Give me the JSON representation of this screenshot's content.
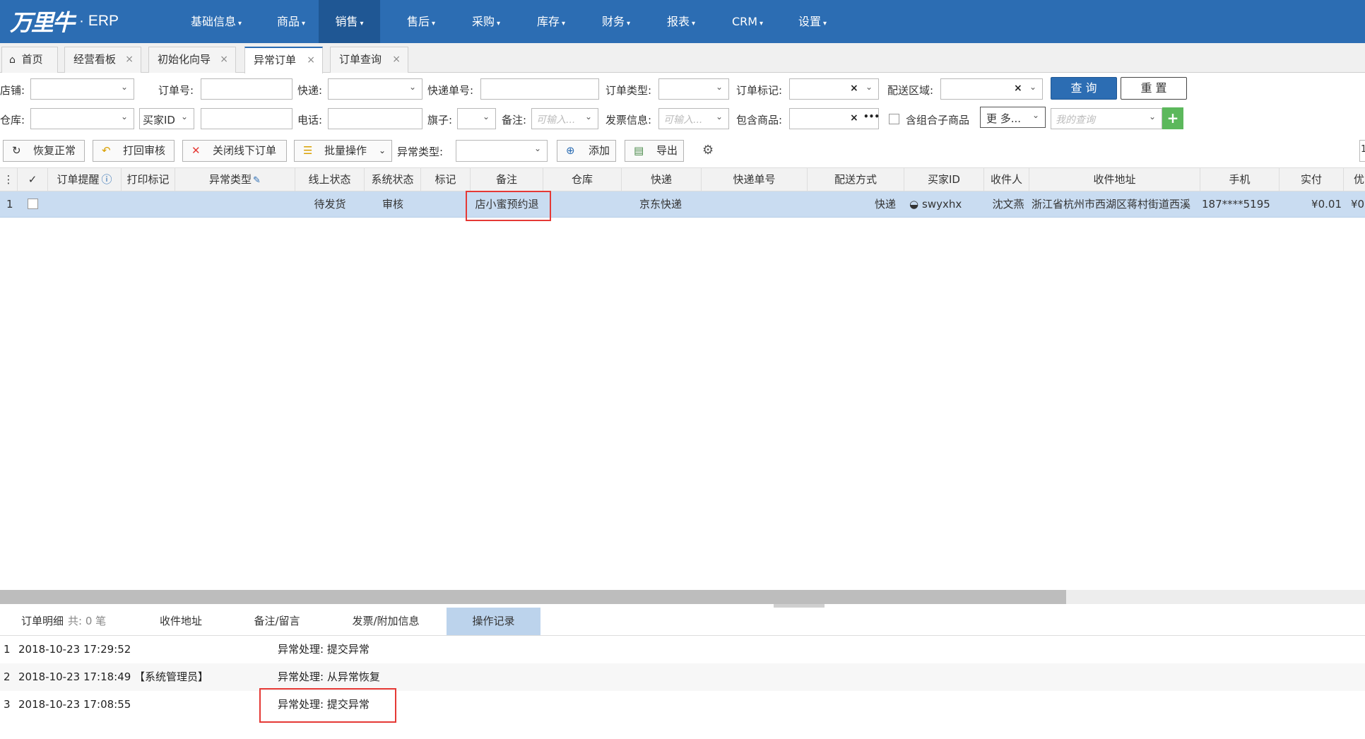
{
  "app": {
    "brand": "万里牛",
    "system": "ERP"
  },
  "nav": [
    {
      "label": "基础信息"
    },
    {
      "label": "商品"
    },
    {
      "label": "销售"
    },
    {
      "label": "售后"
    },
    {
      "label": "采购"
    },
    {
      "label": "库存"
    },
    {
      "label": "财务"
    },
    {
      "label": "报表"
    },
    {
      "label": "CRM"
    },
    {
      "label": "设置"
    }
  ],
  "tabs": [
    {
      "label": "首页"
    },
    {
      "label": "经营看板"
    },
    {
      "label": "初始化向导"
    },
    {
      "label": "异常订单"
    },
    {
      "label": "订单查询"
    }
  ],
  "filters": {
    "shop": "店铺:",
    "order_no": "订单号:",
    "express": "快递:",
    "express_no": "快递单号:",
    "order_type": "订单类型:",
    "order_mark": "订单标记:",
    "region": "配送区域:",
    "warehouse": "仓库:",
    "buyer_id_select": "买家ID",
    "phone": "电话:",
    "flag": "旗子:",
    "remark": "备注:",
    "remark_placeholder": "可输入...",
    "invoice": "发票信息:",
    "invoice_placeholder": "可输入...",
    "contains_goods": "包含商品:",
    "combo_label": "含组合子商品",
    "more": "更 多...",
    "my_query_placeholder": "我的查询",
    "query_btn": "查 询",
    "reset_btn": "重 置",
    "add_query": "+",
    "ellipsis": "•••"
  },
  "toolbar": {
    "restore": "恢复正常",
    "print_back": "打回审核",
    "close_offline": "关闭线下订单",
    "batch": "批量操作",
    "exception_type": "异常类型:",
    "add": "添加",
    "export": "导出",
    "right_edge": "1"
  },
  "grid": {
    "headers": [
      "订单提醒",
      "打印标记",
      "异常类型",
      "线上状态",
      "系统状态",
      "标记",
      "备注",
      "仓库",
      "快递",
      "快递单号",
      "配送方式",
      "买家ID",
      "收件人",
      "收件地址",
      "手机",
      "实付",
      "优"
    ],
    "row": {
      "num": "1",
      "online_status": "待发货",
      "system_status": "审核",
      "remark": "店小蜜预约退",
      "express": "京东快递",
      "delivery": "快递",
      "buyer_id": "swyxhx",
      "receiver": "沈文燕",
      "address": "浙江省杭州市西湖区蒋村街道西溪",
      "mobile": "187****5195",
      "paid": "¥0.01",
      "extra": "¥0"
    }
  },
  "bottom_tabs": {
    "detail": "订单明细",
    "detail_count": "共: 0 笔",
    "address": "收件地址",
    "remark": "备注/留言",
    "invoice": "发票/附加信息",
    "log": "操作记录"
  },
  "logs": [
    {
      "num": "1",
      "time": "2018-10-23 17:29:52",
      "user": "",
      "action": "异常处理: 提交异常"
    },
    {
      "num": "2",
      "time": "2018-10-23 17:18:49",
      "user": "【系统管理员】",
      "action": "异常处理: 从异常恢复"
    },
    {
      "num": "3",
      "time": "2018-10-23 17:08:55",
      "user": "",
      "action": "异常处理: 提交异常"
    }
  ],
  "colors": {
    "nav_bg": "#2c6db3",
    "nav_active": "#1f5794",
    "row_selected": "#c9dcf1",
    "highlight": "#e53935",
    "active_bottom_tab": "#bcd3ec"
  }
}
